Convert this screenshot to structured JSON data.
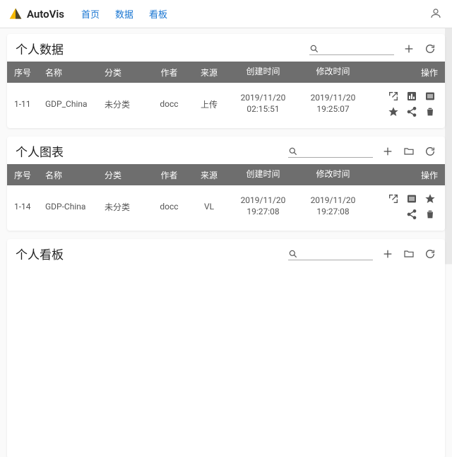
{
  "app": {
    "name": "AutoVis",
    "nav": {
      "home": "首页",
      "data": "数据",
      "board": "看板"
    }
  },
  "sections": {
    "data": {
      "title": "个人数据",
      "headers": {
        "id": "序号",
        "name": "名称",
        "cat": "分类",
        "author": "作者",
        "source": "来源",
        "ctime": "创建时间",
        "mtime": "修改时间",
        "ops": "操作"
      },
      "rows": [
        {
          "id": "1-11",
          "name": "GDP_China",
          "cat": "未分类",
          "author": "docc",
          "source": "上传",
          "ctime_date": "2019/11/20",
          "ctime_time": "02:15:51",
          "mtime_date": "2019/11/20",
          "mtime_time": "19:25:07"
        }
      ]
    },
    "charts": {
      "title": "个人图表",
      "headers": {
        "id": "序号",
        "name": "名称",
        "cat": "分类",
        "author": "作者",
        "source": "来源",
        "ctime": "创建时间",
        "mtime": "修改时间",
        "ops": "操作"
      },
      "rows": [
        {
          "id": "1-14",
          "name": "GDP-China",
          "cat": "未分类",
          "author": "docc",
          "source": "VL",
          "ctime_date": "2019/11/20",
          "ctime_time": "19:27:08",
          "mtime_date": "2019/11/20",
          "mtime_time": "19:27:08"
        }
      ]
    },
    "boards": {
      "title": "个人看板"
    }
  }
}
